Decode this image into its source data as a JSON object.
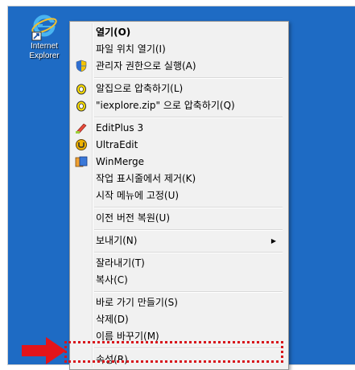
{
  "desktop": {
    "icon_label_line1": "Internet",
    "icon_label_line2": "Explorer",
    "background_color": "#1e6bc4"
  },
  "context_menu": {
    "items": [
      {
        "label": "열기(O)",
        "icon": "",
        "bold": true
      },
      {
        "label": "파일 위치 열기(I)",
        "icon": ""
      },
      {
        "label": "관리자 권한으로 실행(A)",
        "icon": "uac-shield-icon"
      },
      {
        "label": "알집으로 압축하기(L)",
        "icon": "alzip-icon"
      },
      {
        "label": "\"iexplore.zip\" 으로 압축하기(Q)",
        "icon": "alzip-icon"
      },
      {
        "label": "EditPlus 3",
        "icon": "editplus-icon"
      },
      {
        "label": "UltraEdit",
        "icon": "ultraedit-icon"
      },
      {
        "label": "WinMerge",
        "icon": "winmerge-icon"
      },
      {
        "label": "작업 표시줄에서 제거(K)",
        "icon": ""
      },
      {
        "label": "시작 메뉴에 고정(U)",
        "icon": ""
      },
      {
        "label": "이전 버전 복원(U)",
        "icon": ""
      },
      {
        "label": "보내기(N)",
        "icon": "",
        "submenu_arrow": "▶"
      },
      {
        "label": "잘라내기(T)",
        "icon": ""
      },
      {
        "label": "복사(C)",
        "icon": ""
      },
      {
        "label": "바로 가기 만들기(S)",
        "icon": ""
      },
      {
        "label": "삭제(D)",
        "icon": ""
      },
      {
        "label": "이름 바꾸기(M)",
        "icon": ""
      },
      {
        "label": "속성(R)",
        "icon": "",
        "highlighted": true
      }
    ]
  },
  "annotation": {
    "highlight_color": "#d8141a",
    "pointer": "red-arrow"
  }
}
